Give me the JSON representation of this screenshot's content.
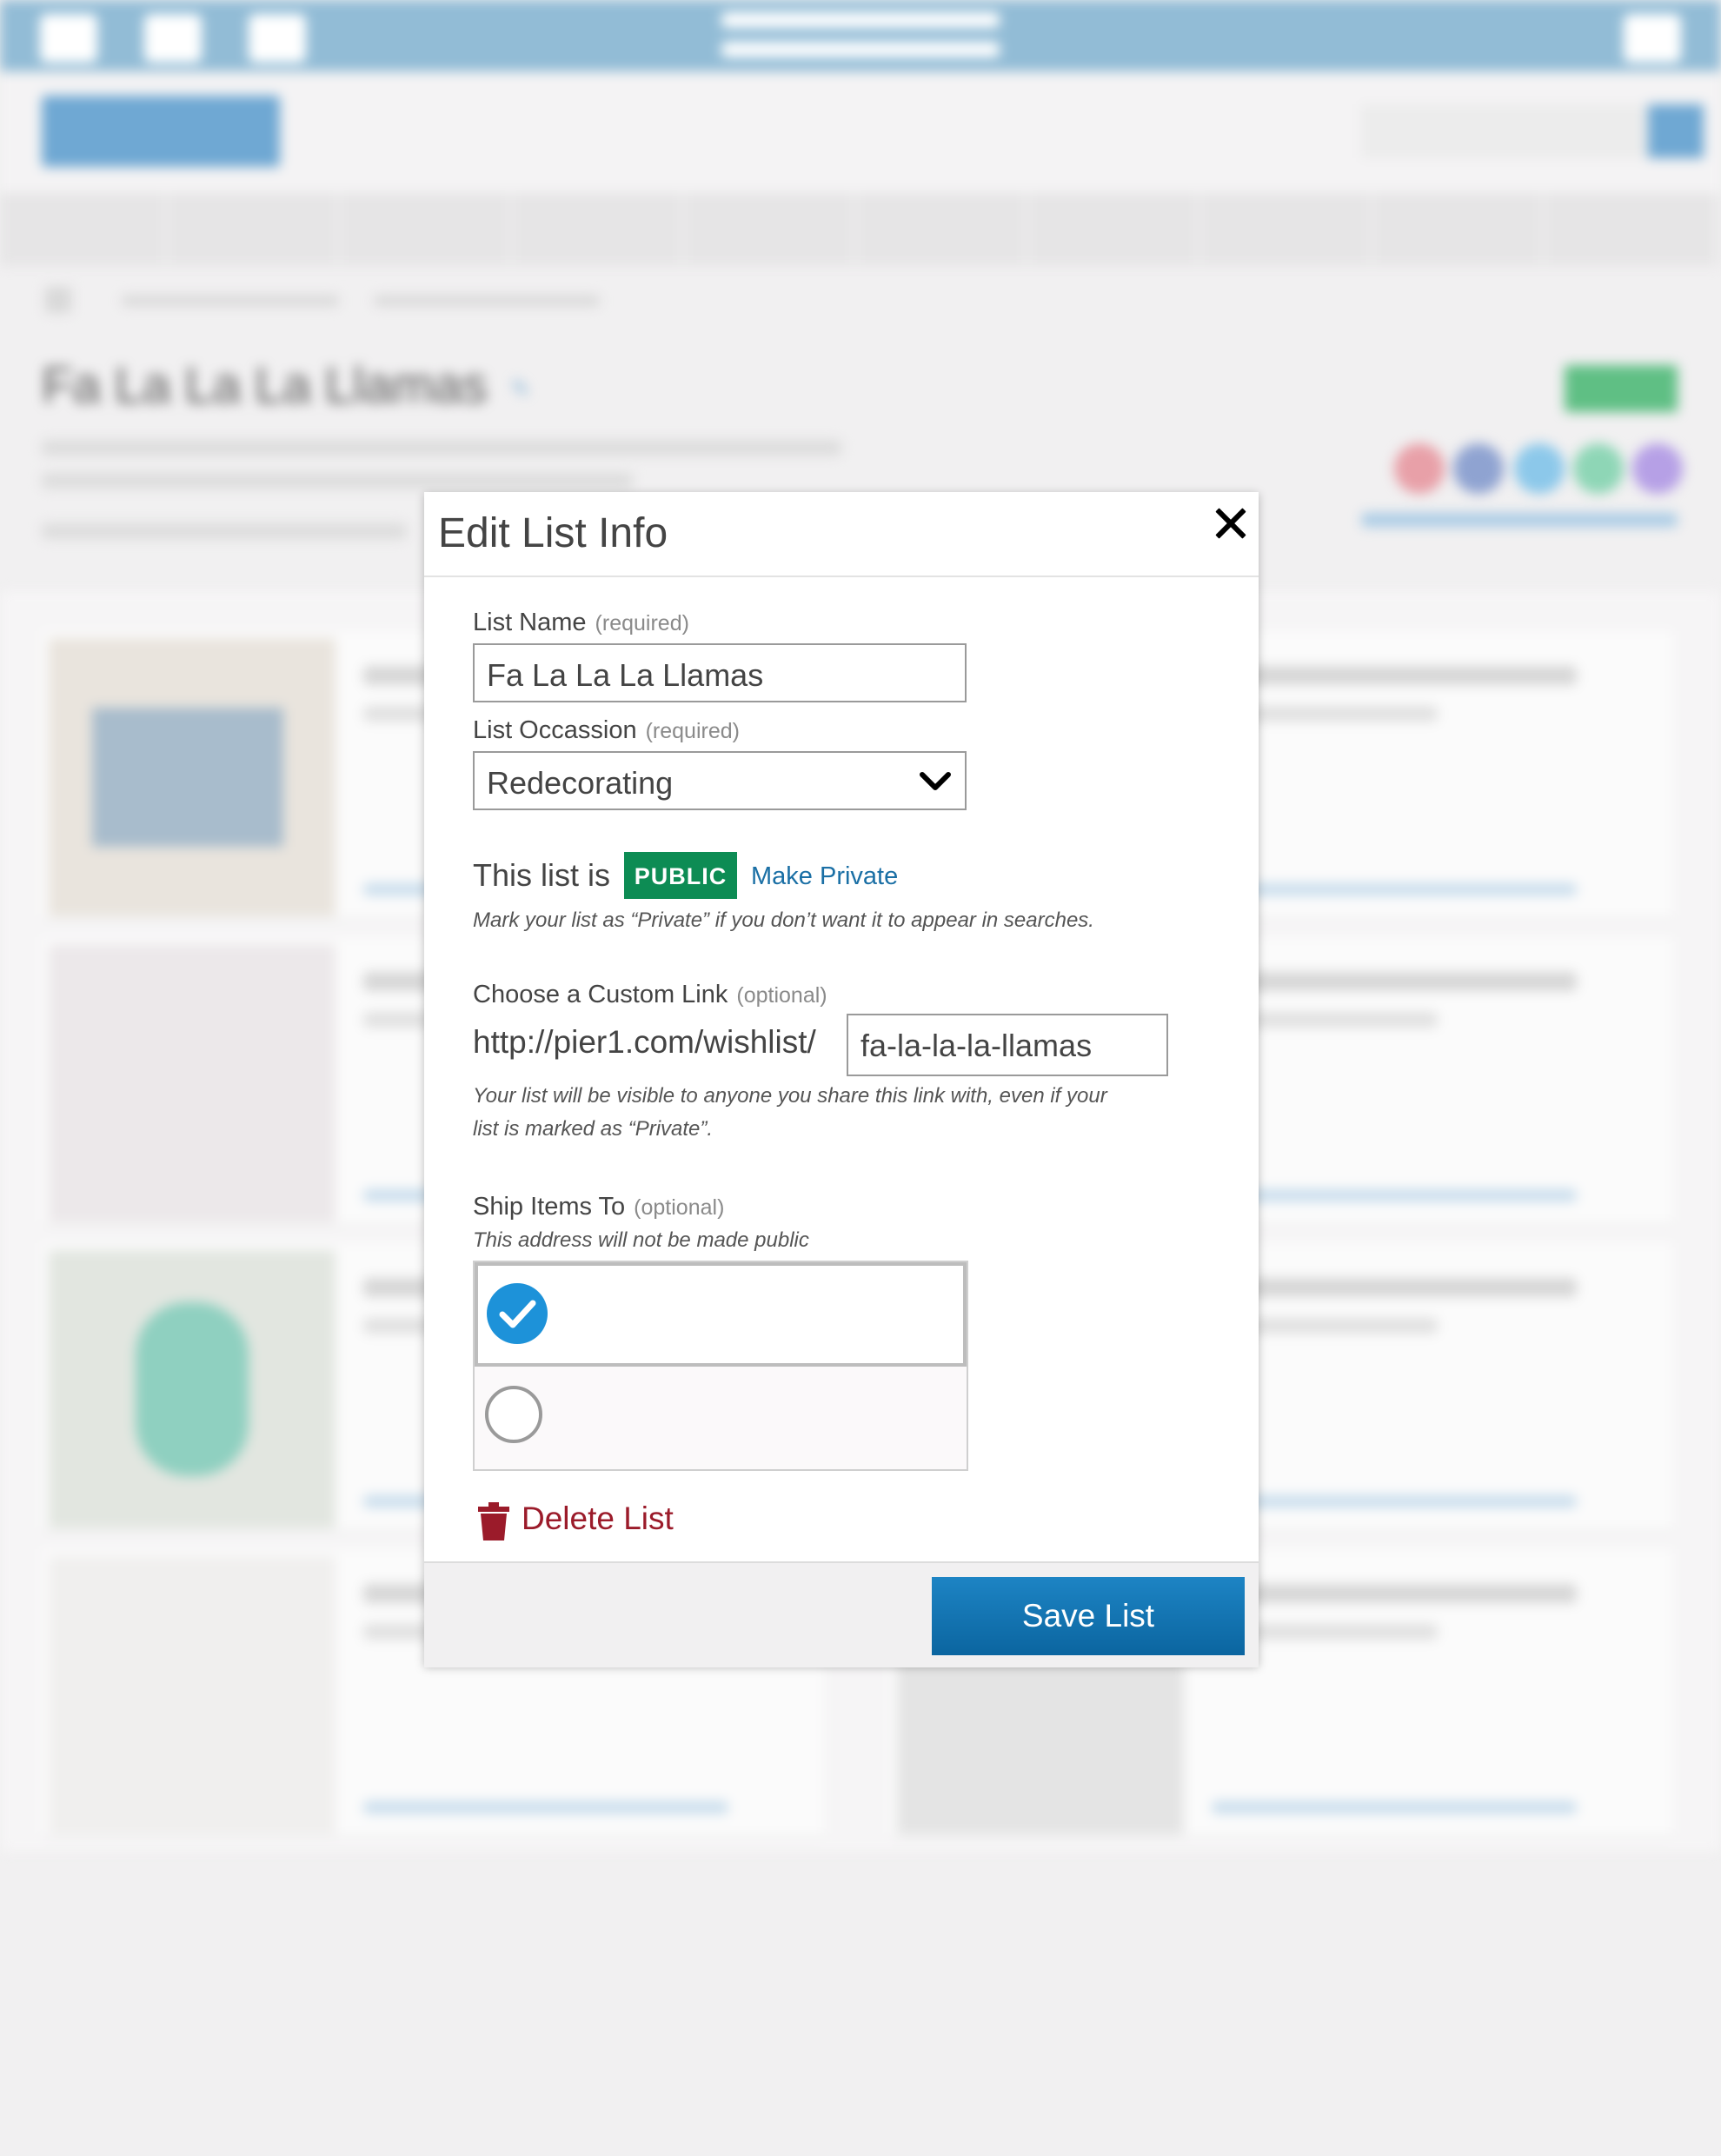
{
  "background": {
    "page_title": "Fa La La La Llamas"
  },
  "modal": {
    "title": "Edit List Info",
    "list_name": {
      "label": "List Name",
      "hint": "(required)",
      "value": "Fa La La La Llamas"
    },
    "occasion": {
      "label": "List Occassion",
      "hint": "(required)",
      "value": "Redecorating"
    },
    "privacy": {
      "prefix": "This list is",
      "status": "PUBLIC",
      "toggle_label": "Make Private",
      "note": "Mark your list as “Private” if you don’t want it to appear in searches."
    },
    "custom_link": {
      "label": "Choose a Custom Link",
      "hint": "(optional)",
      "prefix": "http://pier1.com/wishlist/",
      "value": "fa-la-la-la-llamas",
      "note_line1": "Your list will be visible to anyone you share this link with, even if your",
      "note_line2": "list is marked as “Private”."
    },
    "ship_to": {
      "label": "Ship Items To",
      "hint": "(optional)",
      "note": "This address will not be made public"
    },
    "delete_label": "Delete List",
    "save_label": "Save List"
  },
  "colors": {
    "public_badge": "#0d8c54",
    "link": "#1a6fa5",
    "delete": "#9b1b2a",
    "save_button": "#0b65a0",
    "check": "#1d92d9"
  }
}
